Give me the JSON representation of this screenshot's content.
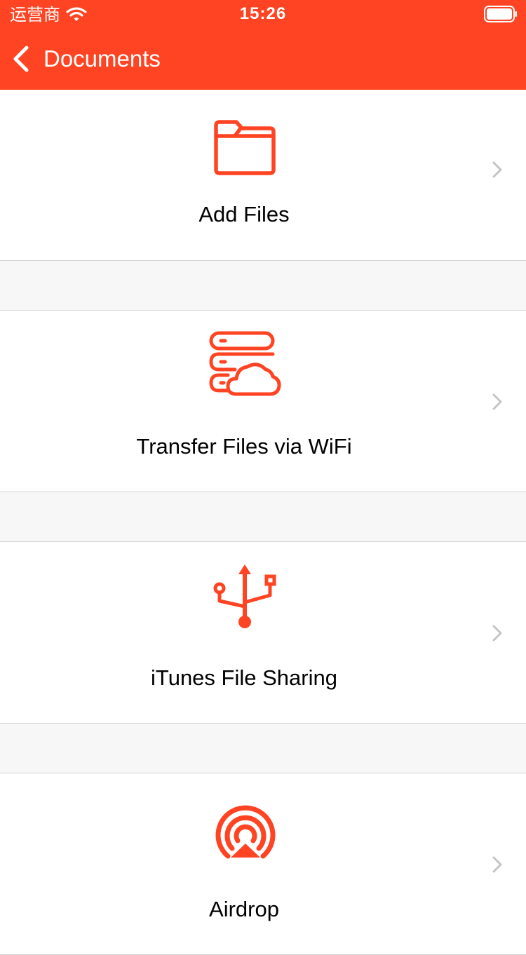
{
  "status_bar": {
    "carrier": "运营商",
    "time": "15:26",
    "wifi_icon": "wifi-icon",
    "battery_icon": "battery-full-icon"
  },
  "nav": {
    "back_icon": "chevron-left-icon",
    "back_label": "Documents"
  },
  "items": [
    {
      "label": "Add Files",
      "icon": "folder-icon"
    },
    {
      "label": "Transfer Files via WiFi",
      "icon": "server-cloud-icon"
    },
    {
      "label": "iTunes File Sharing",
      "icon": "usb-icon"
    },
    {
      "label": "Airdrop",
      "icon": "airdrop-icon"
    }
  ],
  "colors": {
    "accent": "#FF4423",
    "background": "#FFFFFF",
    "separator_background": "#F7F7F7",
    "chevron": "#C4C4C7",
    "text": "#000000"
  }
}
